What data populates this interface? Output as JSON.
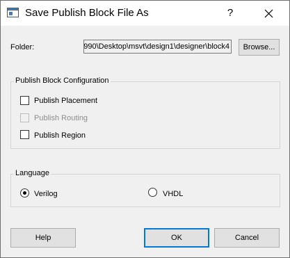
{
  "titlebar": {
    "title": "Save Publish Block File As",
    "help_label": "?",
    "app_icon": "window-icon",
    "close_icon": "close-icon"
  },
  "folder": {
    "label": "Folder:",
    "value": "990\\Desktop\\msvt\\design1\\designer\\block4",
    "browse_label": "Browse..."
  },
  "config": {
    "title": "Publish Block Configuration",
    "options": [
      {
        "label": "Publish Placement",
        "checked": false,
        "enabled": true
      },
      {
        "label": "Publish Routing",
        "checked": false,
        "enabled": false
      },
      {
        "label": "Publish Region",
        "checked": false,
        "enabled": true
      }
    ]
  },
  "language": {
    "title": "Language",
    "options": [
      {
        "label": "Verilog",
        "selected": true
      },
      {
        "label": "VHDL",
        "selected": false
      }
    ]
  },
  "footer": {
    "help_label": "Help",
    "ok_label": "OK",
    "cancel_label": "Cancel"
  }
}
